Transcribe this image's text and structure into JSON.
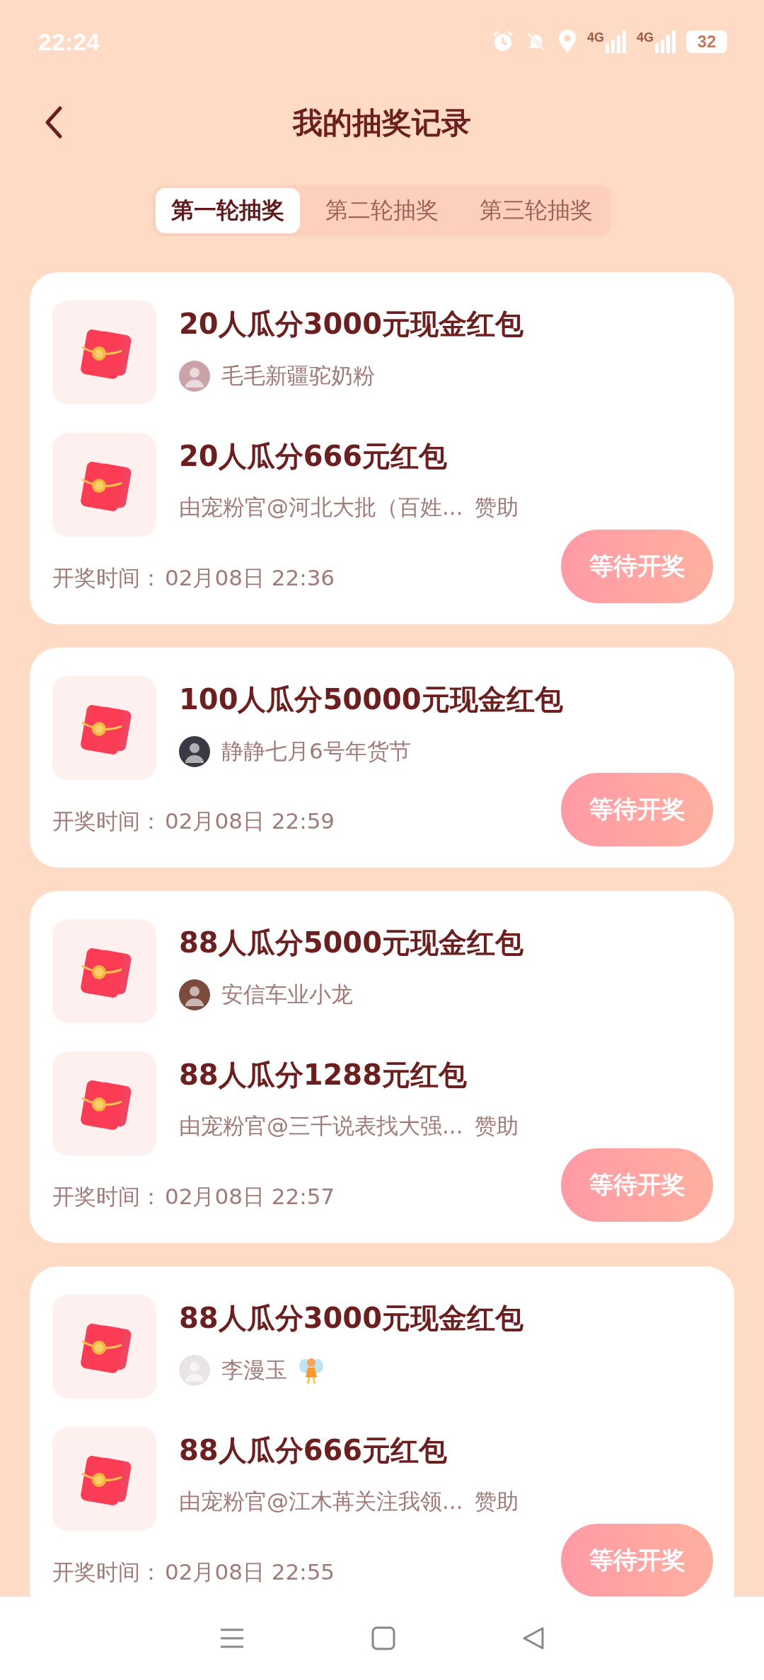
{
  "status_bar": {
    "time": "22:24",
    "network_labels": [
      "4G",
      "4G"
    ],
    "battery": "32"
  },
  "header": {
    "title": "我的抽奖记录"
  },
  "tabs": [
    {
      "label": "第一轮抽奖",
      "selected": true
    },
    {
      "label": "第二轮抽奖",
      "selected": false
    },
    {
      "label": "第三轮抽奖",
      "selected": false
    }
  ],
  "records": [
    {
      "prizes": [
        {
          "kind": "host",
          "title": "20人瓜分3000元现金红包",
          "host": "毛毛新疆驼奶粉"
        },
        {
          "kind": "sponsored",
          "title": "20人瓜分666元红包",
          "sponsor": "由宠粉官@河北大批（百姓...",
          "suffix": "赞助"
        }
      ],
      "time_label": "开奖时间：",
      "time": "02月08日 22:36",
      "button": "等待开奖"
    },
    {
      "prizes": [
        {
          "kind": "host",
          "title": "100人瓜分50000元现金红包",
          "host": "静静七月6号年货节"
        }
      ],
      "time_label": "开奖时间：",
      "time": "02月08日 22:59",
      "button": "等待开奖"
    },
    {
      "prizes": [
        {
          "kind": "host",
          "title": "88人瓜分5000元现金红包",
          "host": "安信车业小龙"
        },
        {
          "kind": "sponsored",
          "title": "88人瓜分1288元红包",
          "sponsor": "由宠粉官@三千说表找大强...",
          "suffix": "赞助"
        }
      ],
      "time_label": "开奖时间：",
      "time": "02月08日 22:57",
      "button": "等待开奖"
    },
    {
      "prizes": [
        {
          "kind": "host",
          "title": "88人瓜分3000元现金红包",
          "host": "李漫玉",
          "fairy_badge": true
        },
        {
          "kind": "sponsored",
          "title": "88人瓜分666元红包",
          "sponsor": "由宠粉官@江木苒关注我领...",
          "suffix": "赞助"
        }
      ],
      "time_label": "开奖时间：",
      "time": "02月08日 22:55",
      "button": "等待开奖"
    }
  ]
}
